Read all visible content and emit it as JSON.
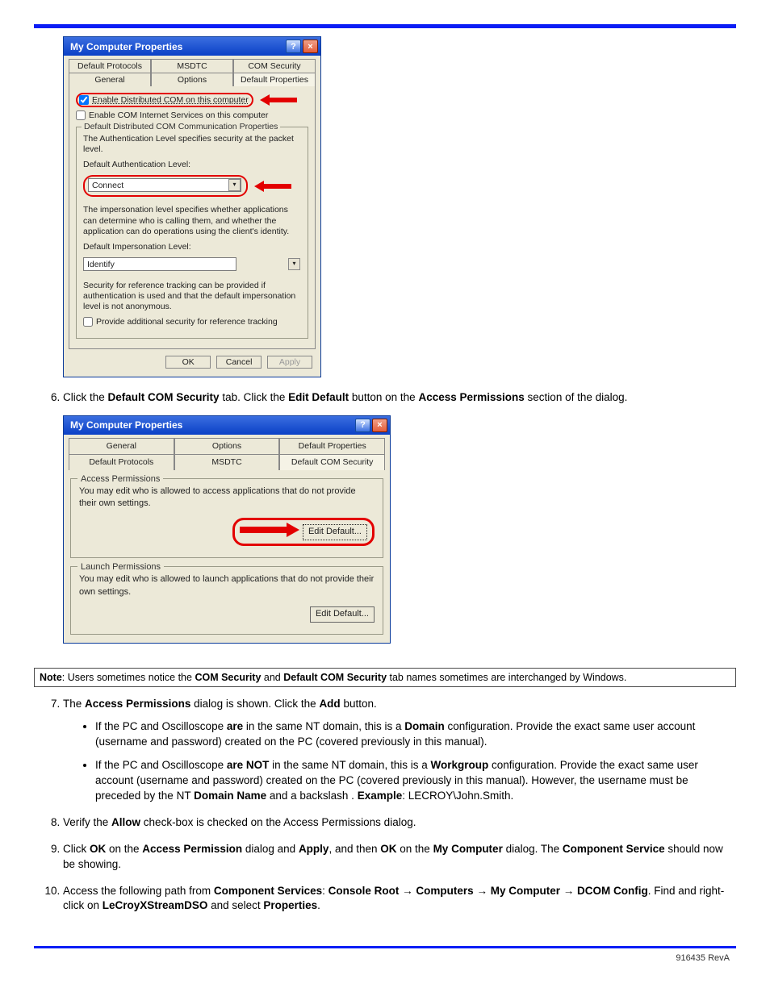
{
  "dialog1": {
    "title": "My Computer Properties",
    "tabs_back": [
      "Default Protocols",
      "MSDTC",
      "COM Security"
    ],
    "tabs_front": [
      "General",
      "Options",
      "Default Properties"
    ],
    "chk_enable_dcom": "Enable Distributed COM on this computer",
    "chk_enable_cis": "Enable COM Internet Services on this computer",
    "group_comm_title": "Default Distributed COM Communication Properties",
    "auth_text": "The Authentication Level specifies security at the packet level.",
    "auth_label": "Default Authentication Level:",
    "auth_value": "Connect",
    "imp_text": "The impersonation level specifies whether applications can determine who is calling them, and whether the application can do operations using the client's identity.",
    "imp_label": "Default Impersonation Level:",
    "imp_value": "Identify",
    "sec_text": "Security for reference tracking can be provided if authentication is used and that the default impersonation level is not anonymous.",
    "chk_ref_track": "Provide additional security for reference tracking",
    "btn_ok": "OK",
    "btn_cancel": "Cancel",
    "btn_apply": "Apply"
  },
  "step6": {
    "pre": "Click the ",
    "b1": "Default COM Security",
    "mid1": " tab. Click the ",
    "b2": "Edit Default",
    "mid2": " button on the ",
    "b3": "Access Permissions",
    "post": " section of the dialog."
  },
  "dialog2": {
    "title": "My Computer Properties",
    "tabs_back": [
      "General",
      "Options",
      "Default Properties"
    ],
    "tabs_front": [
      "Default Protocols",
      "MSDTC",
      "Default COM Security"
    ],
    "group_access_title": "Access Permissions",
    "group_access_text": "You may edit who is allowed to access applications that do not provide their own settings.",
    "group_launch_title": "Launch Permissions",
    "group_launch_text": "You may edit who is allowed to launch applications that do not provide their own settings.",
    "edit_default": "Edit Default..."
  },
  "note": {
    "pre": "Note",
    "t1": ": Users sometimes notice the ",
    "b1": "COM Security",
    "t2": " and ",
    "b2": "Default COM Security",
    "t3": " tab names sometimes are interchanged by Windows."
  },
  "step7": {
    "pre": "The ",
    "b1": "Access Permissions",
    "mid": " dialog is shown. Click the ",
    "b2": "Add",
    "post": " button.",
    "bullet1": {
      "t1": "If the PC and Oscilloscope ",
      "b1": "are",
      "t2": " in the same NT domain, this is a ",
      "b2": "Domain",
      "t3": " configuration. Provide the exact same user account (username and password) created on the PC (covered previously in this manual)."
    },
    "bullet2": {
      "t1": "If the PC and Oscilloscope ",
      "b1": "are NOT",
      "t2": " in the same NT domain, this is a ",
      "b2": "Workgroup",
      "t3": " configuration. Provide the exact same user account (username and password) created on the PC (covered previously in this manual). However, the username must be preceded by the NT ",
      "b3": "Domain Name",
      "t4": " and a backslash  . ",
      "b4": "Example",
      "t5": ": LECROY\\John.Smith."
    }
  },
  "step8": {
    "t1": "Verify the ",
    "b1": "Allow",
    "t2": " check-box is checked on the Access Permissions dialog."
  },
  "step9": {
    "t1": "Click ",
    "b1": "OK",
    "t2": " on the ",
    "b2": "Access Permission",
    "t3": " dialog and ",
    "b3": "Apply",
    "t4": ", and then ",
    "b4": "OK",
    "t5": " on the ",
    "b5": "My Computer",
    "t6": " dialog. The ",
    "b6": "Component Service",
    "t7": " should now be showing."
  },
  "step10": {
    "t1": "Access the following path from ",
    "b1": "Component Services",
    "t2": ": ",
    "b2": "Console Root",
    "arr": " → ",
    "b3": "Computers",
    "b4": "My Computer",
    "b5": "DCOM Config",
    "t3": ". Find and right-click on ",
    "b6": "LeCroyXStreamDSO",
    "t4": " and select ",
    "b7": "Properties",
    "t5": "."
  },
  "footer": "916435 RevA"
}
